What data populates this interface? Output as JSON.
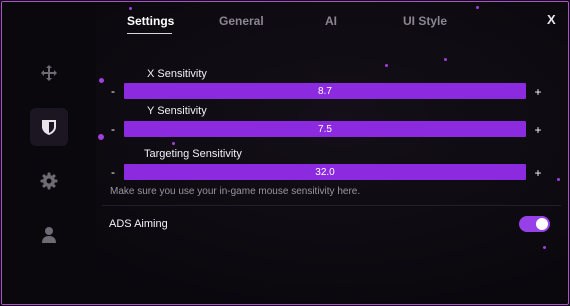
{
  "tabs": [
    {
      "label": "Settings",
      "active": true
    },
    {
      "label": "General",
      "active": false
    },
    {
      "label": "AI",
      "active": false
    },
    {
      "label": "UI Style",
      "active": false
    }
  ],
  "close_label": "X",
  "sidebar": {
    "items": [
      {
        "icon": "crosshair-move-icon",
        "active": false
      },
      {
        "icon": "shield-icon",
        "active": true
      },
      {
        "icon": "gear-icon",
        "active": false
      },
      {
        "icon": "user-icon",
        "active": false
      }
    ]
  },
  "sliders": [
    {
      "label": "X Sensitivity",
      "value": "8.7",
      "minus": "-",
      "plus": "+"
    },
    {
      "label": "Y Sensitivity",
      "value": "7.5",
      "minus": "-",
      "plus": "+"
    },
    {
      "label": "Targeting Sensitivity",
      "value": "32.0",
      "minus": "-",
      "plus": "+"
    }
  ],
  "hint": "Make sure you use your in-game mouse sensitivity here.",
  "ads": {
    "label": "ADS Aiming",
    "enabled": true
  },
  "colors": {
    "accent": "#8c2ae0",
    "border": "#b04fd0",
    "background": "#0d0a11"
  }
}
